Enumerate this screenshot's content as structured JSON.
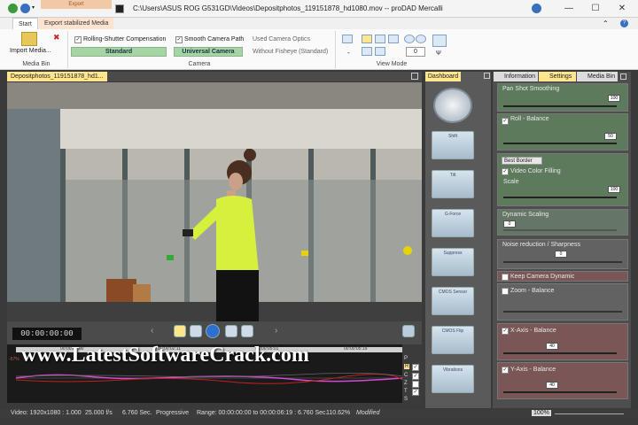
{
  "window": {
    "title": "C:\\Users\\ASUS ROG G531GD\\Videos\\Depositphotos_119151878_hd1080.mov -- proDAD Mercalli",
    "context_tab": "Export",
    "minimize": "—",
    "maximize": "☐",
    "close": "✕"
  },
  "ribbon_tabs": {
    "start": "Start",
    "export": "Export stabilized Media"
  },
  "media_bin": {
    "import_label": "Import Media...",
    "group_label": "Media Bin"
  },
  "camera": {
    "rolling_shutter": "Rolling-Shutter Compensation",
    "rolling_shutter_mode": "Standard",
    "smooth_path": "Smooth Camera Path",
    "camera_model": "Universal Camera",
    "used_optics": "Used Camera Optics",
    "optics_value": "Without Fisheye (Standard)",
    "group_label": "Camera"
  },
  "view_mode": {
    "group_label": "View Mode",
    "spinner_value": "0"
  },
  "video_panel": {
    "tab_label": "Depositphotos_119151878_hd1...",
    "timecode": "00:00:00:00"
  },
  "timeline": {
    "ticks": [
      "00:00:00:00",
      "00:00:02:11",
      "00:00:05:01",
      "00:00:05:19"
    ],
    "left_label": "-57%",
    "track_labels": [
      "P",
      "R",
      "C",
      "Z",
      "T",
      "S"
    ]
  },
  "dashboard": {
    "tab_label": "Dashboard",
    "buttons": [
      "Shift",
      "Tilt",
      "G-Force",
      "Suppress",
      "CMOS Sensor",
      "CMOS Flip",
      "Vibrations"
    ]
  },
  "right_tabs": {
    "information": "Information",
    "settings": "Settings",
    "media_bin": "Media Bin"
  },
  "settings": {
    "pan_shot": {
      "label": "Pan Shot Smoothing",
      "value": "100"
    },
    "roll": {
      "label": "Roll - Balance",
      "value": "50"
    },
    "border_mode": "Best Border",
    "video_color_filling": "Video Color Filling",
    "scale": {
      "label": "Scale",
      "value": "100"
    },
    "dynamic_scaling": {
      "label": "Dynamic Scaling",
      "value": "0"
    },
    "noise": {
      "label": "Noise reduction / Sharpness",
      "value": "0"
    },
    "keep_dynamic": "Keep Camera Dynamic",
    "zoom": {
      "label": "Zoom - Balance"
    },
    "x_axis": {
      "label": "X-Axis - Balance",
      "value": "40"
    },
    "y_axis": {
      "label": "Y-Axis - Balance",
      "value": "40"
    }
  },
  "status": {
    "video": "Video: 1920x1080 : 1.000",
    "fps": "25.000 f/s",
    "duration": "6.760 Sec.",
    "scan": "Progressive",
    "range": "Range: 00:00:00:00 to 00:00:06:19 : 6.760 Sec.",
    "zoom_pct": "110.62%",
    "state": "Modified",
    "zoom_level": "100%"
  },
  "watermark": "www.LatestSoftwareCrack.com",
  "colors": {
    "accent_yellow": "#ffe58c",
    "combo_green": "#a5d4a5",
    "section_green": "#5d7a5d",
    "section_maroon": "#7a5656"
  }
}
